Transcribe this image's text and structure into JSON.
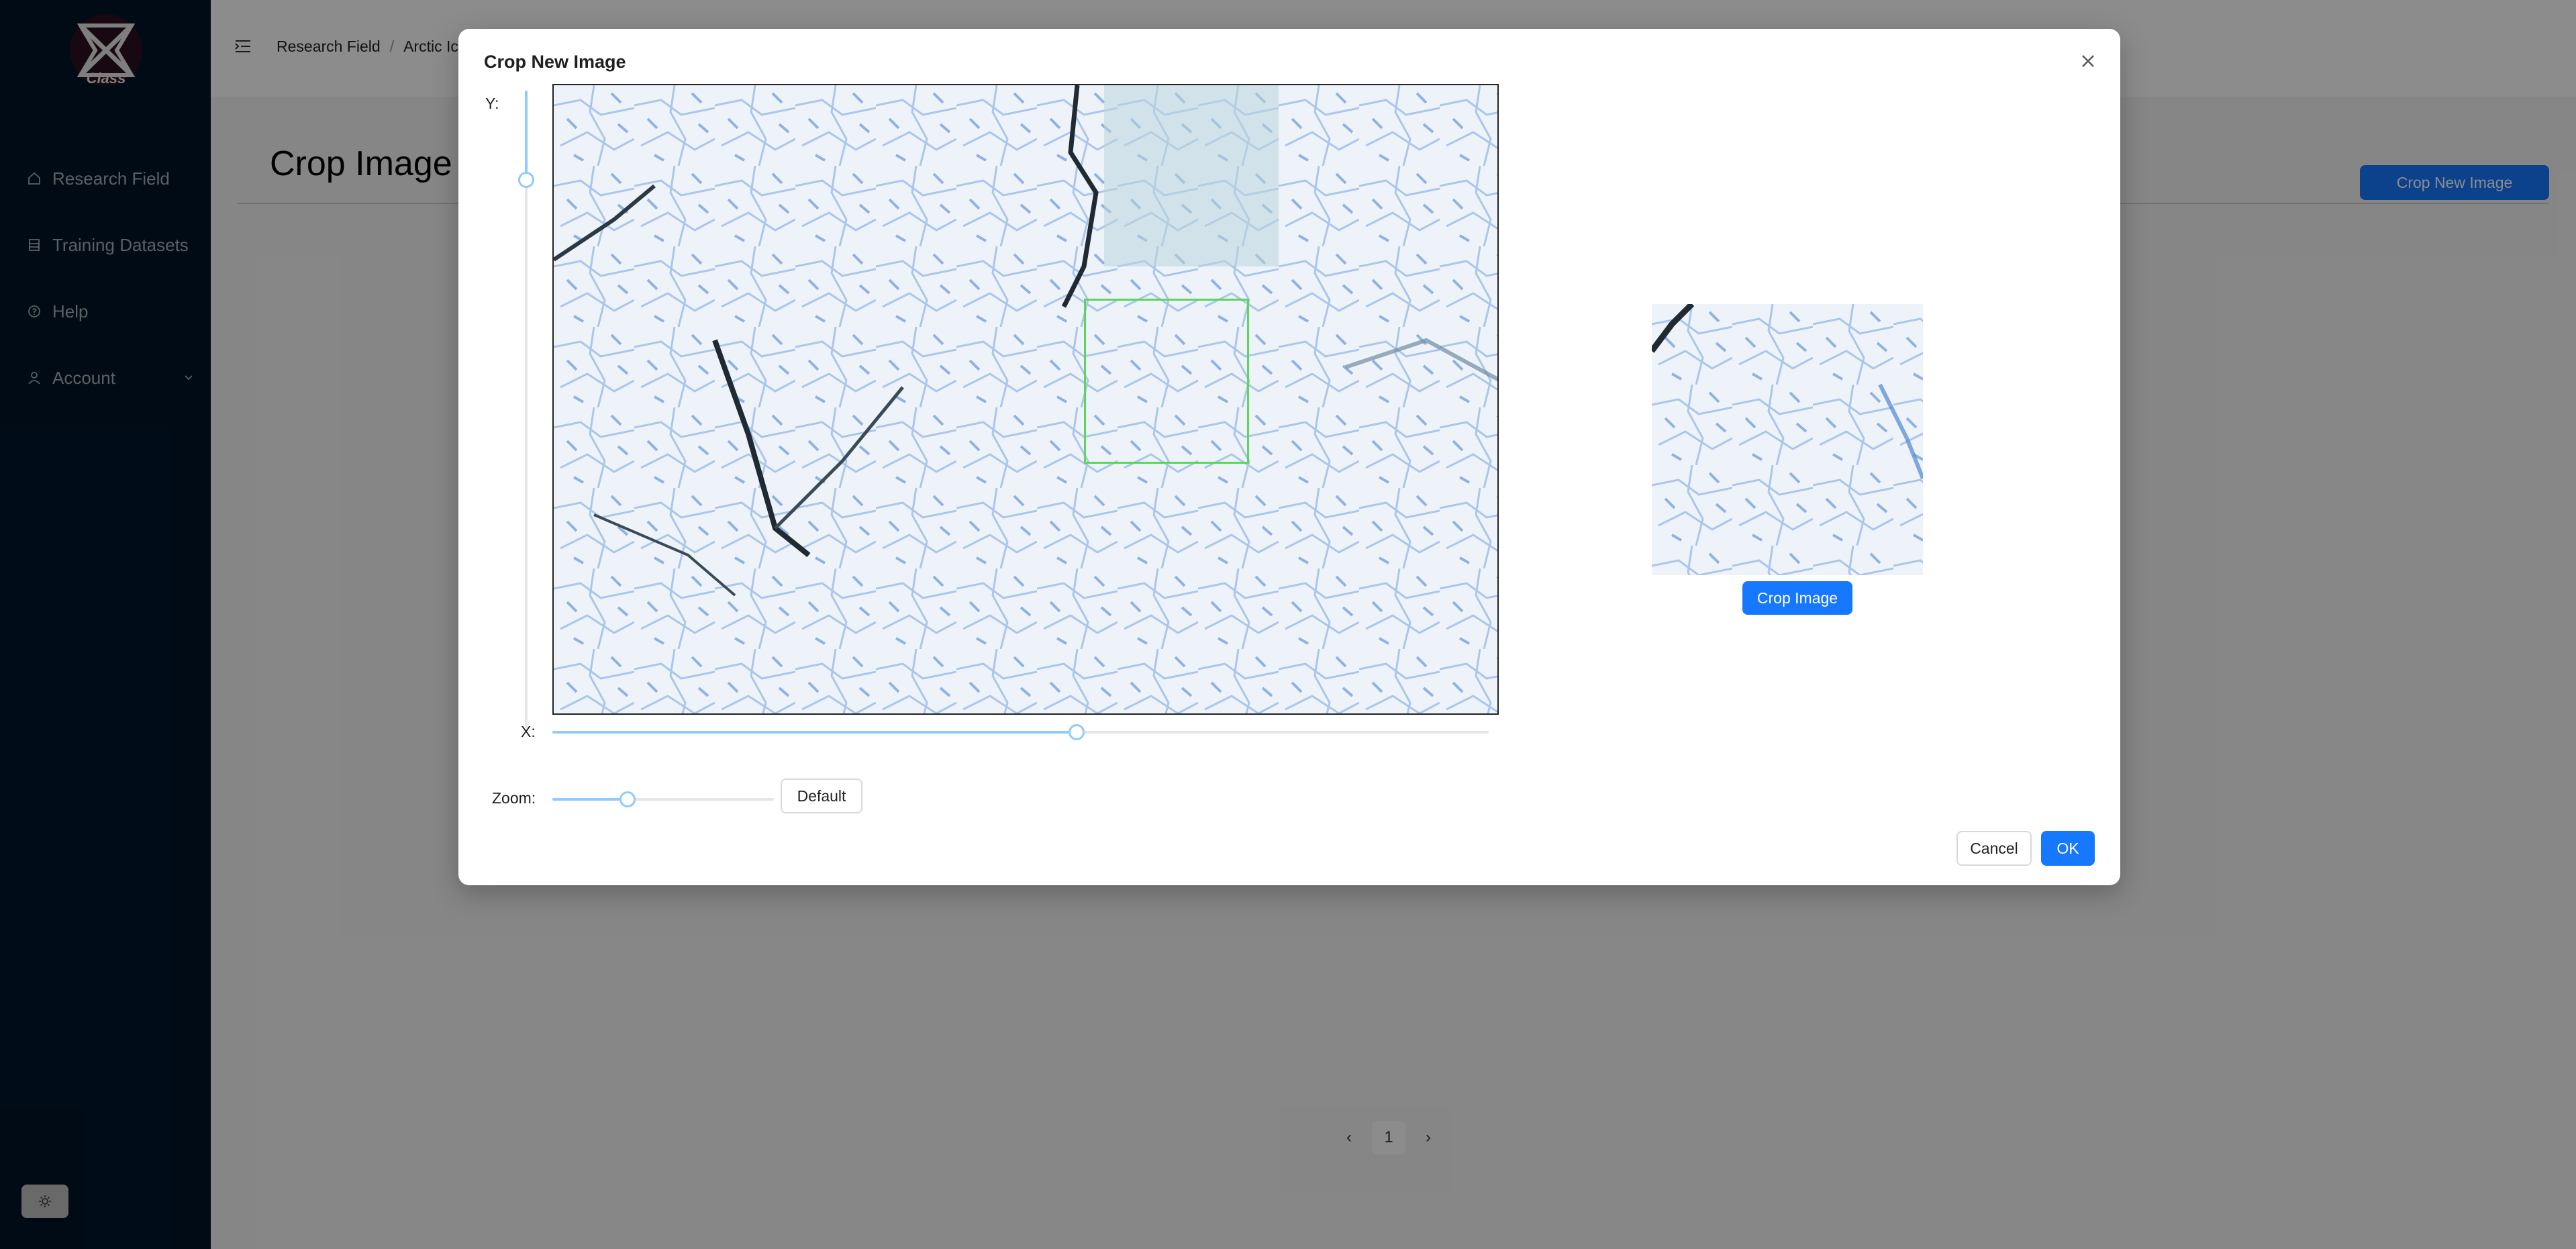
{
  "sidebar": {
    "logo_text": "Class",
    "items": [
      {
        "label": "Research Field",
        "icon": "home-icon"
      },
      {
        "label": "Training Datasets",
        "icon": "database-icon"
      },
      {
        "label": "Help",
        "icon": "question-circle-icon"
      },
      {
        "label": "Account",
        "icon": "user-icon"
      }
    ],
    "theme_toggle_icon": "sun-icon"
  },
  "header": {
    "breadcrumb": [
      "Research Field",
      "Arctic Ice"
    ]
  },
  "page": {
    "title": "Crop Image I",
    "action_label": "Crop New Image",
    "pagination": {
      "current": "1"
    }
  },
  "modal": {
    "title": "Crop New Image",
    "y_label": "Y:",
    "x_label": "X:",
    "zoom_label": "Zoom:",
    "y_value_fraction": 0.14,
    "x_value_fraction": 0.56,
    "zoom_value_fraction": 0.34,
    "default_label": "Default",
    "crop_button_label": "Crop Image",
    "cancel_label": "Cancel",
    "ok_label": "OK",
    "colors": {
      "primary": "#1677ff",
      "crop_box": "#5bd65b",
      "slider": "#91caff"
    }
  }
}
